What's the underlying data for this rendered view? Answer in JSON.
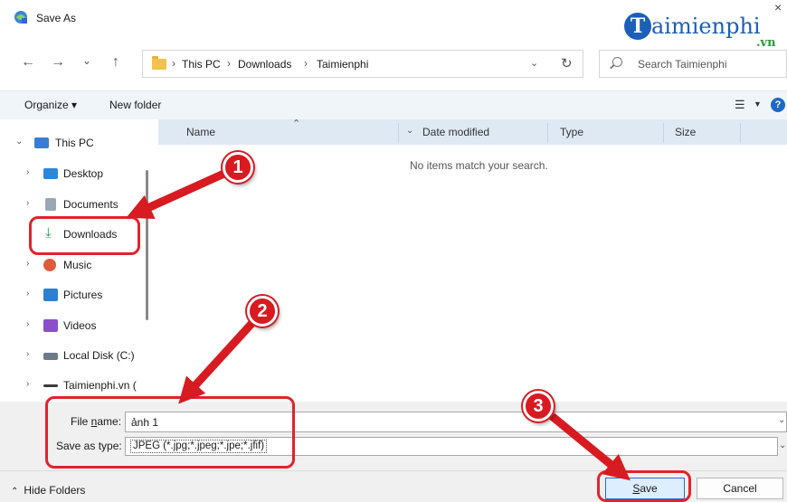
{
  "window": {
    "title": "Save As",
    "close_glyph": "×"
  },
  "watermark": {
    "initial": "T",
    "name": "aimienphi",
    "suffix": ".vn"
  },
  "nav": {
    "back": "←",
    "forward": "→",
    "recent": "⌄",
    "up": "↑"
  },
  "address": {
    "crumbs": [
      "This PC",
      "Downloads",
      "Taimienphi"
    ],
    "separator": "›"
  },
  "search": {
    "placeholder": "Search Taimienphi"
  },
  "toolbar": {
    "organize": "Organize ▾",
    "new_folder": "New folder",
    "help": "?"
  },
  "sidebar": {
    "items": [
      {
        "label": "This PC",
        "icon": "monitor-icon",
        "expanded": true
      },
      {
        "label": "Desktop",
        "icon": "desktop-icon"
      },
      {
        "label": "Documents",
        "icon": "documents-icon"
      },
      {
        "label": "Downloads",
        "icon": "download-icon",
        "selected": true
      },
      {
        "label": "Music",
        "icon": "music-icon"
      },
      {
        "label": "Pictures",
        "icon": "pictures-icon"
      },
      {
        "label": "Videos",
        "icon": "videos-icon"
      },
      {
        "label": "Local Disk (C:)",
        "icon": "disk-icon"
      },
      {
        "label": "Taimienphi.vn (",
        "icon": "drive-icon"
      }
    ]
  },
  "columns": [
    "Name",
    "Date modified",
    "Type",
    "Size"
  ],
  "empty_message": "No items match your search.",
  "form": {
    "file_name_label_pre": "File ",
    "file_name_label_key": "n",
    "file_name_label_post": "ame:",
    "file_name_value": "ảnh 1",
    "save_as_type_label": "Save as type:",
    "save_as_type_value": "JPEG (*.jpg;*.jpeg;*.jpe;*.jfif)"
  },
  "footer": {
    "hide_folders": "Hide Folders",
    "save_key": "S",
    "save_rest": "ave",
    "cancel": "Cancel"
  },
  "annotations": {
    "step1": "1",
    "step2": "2",
    "step3": "3"
  },
  "colors": {
    "annotation_red": "#e0242a",
    "accent_blue": "#1f68c9",
    "watermark_green": "#2e9a3a"
  }
}
